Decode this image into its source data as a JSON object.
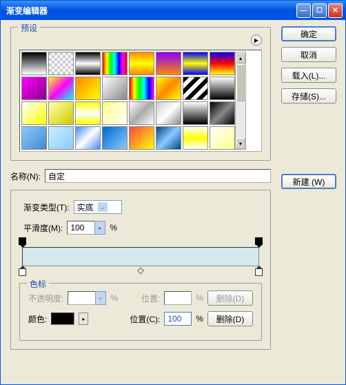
{
  "title": "渐变编辑器",
  "buttons": {
    "ok": "确定",
    "cancel": "取消",
    "load": "载入(L)...",
    "save": "存储(S)...",
    "new": "新建 (W)"
  },
  "presets": {
    "legend": "预设"
  },
  "name": {
    "label": "名称(N):",
    "value": "自定"
  },
  "gradientType": {
    "label": "渐变类型(T):",
    "value": "实底"
  },
  "smoothness": {
    "label": "平滑度(M):",
    "value": "100",
    "unit": "%"
  },
  "stops": {
    "legend": "色标",
    "opacity": {
      "label": "不透明度:",
      "value": "",
      "unit": "%"
    },
    "position1": {
      "label": "位置:",
      "value": "",
      "unit": "%"
    },
    "delete1": "删除(D)",
    "color": {
      "label": "颜色:"
    },
    "position2": {
      "label": "位置(C):",
      "value": "100",
      "unit": "%"
    },
    "delete2": "删除(D)"
  },
  "swatches": [
    "linear-gradient(to bottom,#000,#fff)",
    "repeating-conic-gradient(#ccc 0 25%,#fff 0 50%) 0/8px 8px",
    "linear-gradient(to bottom,#000,#fff,#000)",
    "linear-gradient(to right,#f00,#ff0,#0f0,#0ff,#00f,#f0f,#f00)",
    "linear-gradient(to bottom,#f80,#ff0,#f80)",
    "linear-gradient(to bottom,#80f,#f80)",
    "linear-gradient(to bottom,#00f,#ff0,#00f)",
    "linear-gradient(to bottom,#00f,#f00,#ff0)",
    "linear-gradient(135deg,#f0f,#808)",
    "linear-gradient(135deg,#ff0,#f0f,#0ff)",
    "linear-gradient(135deg,#f80,#ff0)",
    "linear-gradient(135deg,#fff,#888)",
    "linear-gradient(to right,#f00,#ff0,#0f0,#0ff,#00f,#f0f)",
    "linear-gradient(135deg,#ff0,#f80,#ff0)",
    "repeating-linear-gradient(135deg,#000 0 6px,#fff 6px 12px)",
    "linear-gradient(to bottom,#fff,#000)",
    "linear-gradient(135deg,#fff,#ff0)",
    "linear-gradient(135deg,#ffa,#cc0)",
    "linear-gradient(to bottom,#ff0,#fff,#ff0)",
    "linear-gradient(135deg,#ff8,#fff)",
    "linear-gradient(135deg,#fff,#aaa,#fff)",
    "linear-gradient(135deg,#ccc,#fff,#888)",
    "linear-gradient(to bottom,#fff,#000)",
    "linear-gradient(135deg,#000,#888,#000)",
    "linear-gradient(135deg,#8cf,#48c)",
    "linear-gradient(135deg,#cef,#8cf)",
    "linear-gradient(135deg,#48f,#fff,#48f)",
    "linear-gradient(135deg,#06c,#8cf)",
    "linear-gradient(135deg,#f44,#ff0)",
    "linear-gradient(135deg,#048,#8cf,#048)",
    "linear-gradient(to bottom,#fff,#ff0,#fff)",
    "linear-gradient(135deg,#fff,#ff8)"
  ]
}
